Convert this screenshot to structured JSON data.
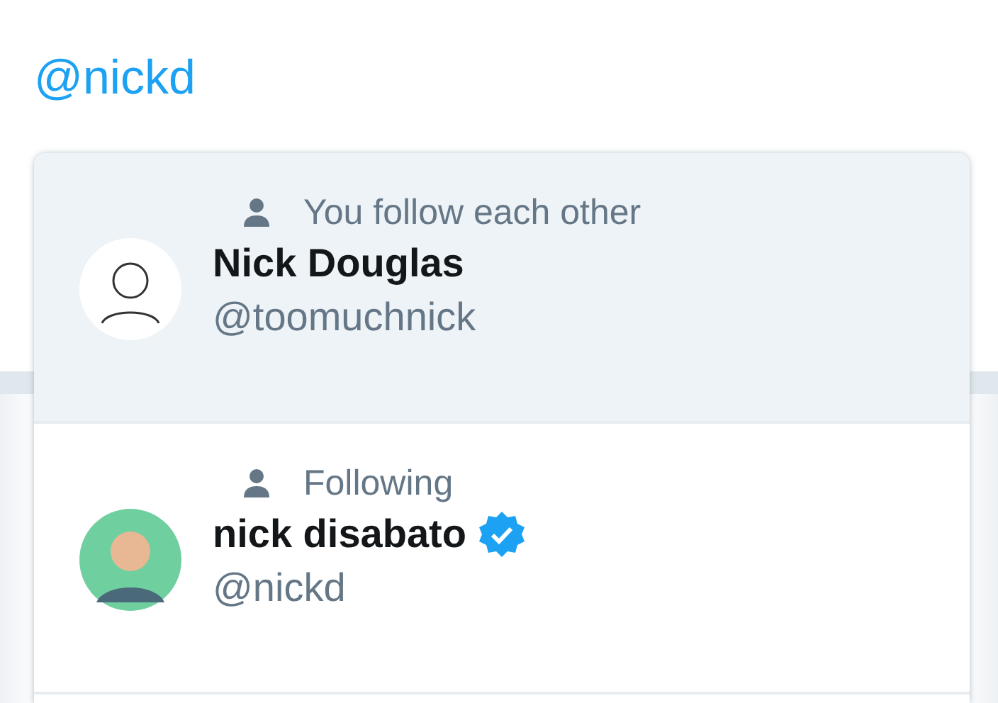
{
  "compose": {
    "value": "@nickd"
  },
  "suggestions": [
    {
      "context": "You follow each other",
      "name": "Nick Douglas",
      "handle": "@toomuchnick",
      "verified": false,
      "selected": true
    },
    {
      "context": "Following",
      "name": "nick disabato",
      "handle": "@nickd",
      "verified": true,
      "selected": false
    }
  ]
}
